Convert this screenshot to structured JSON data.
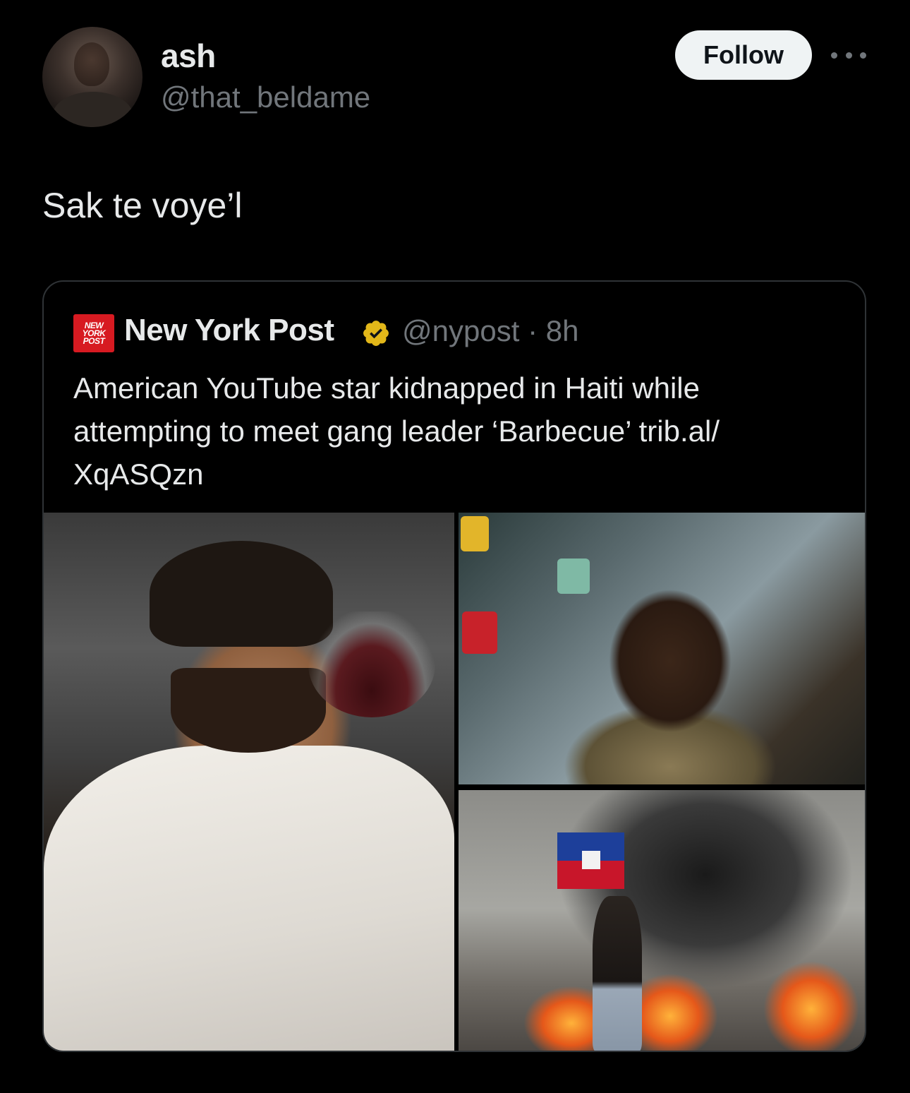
{
  "author": {
    "display_name": "ash",
    "handle": "@that_beldame",
    "follow_label": "Follow"
  },
  "tweet": {
    "text": "Sak te voye’l"
  },
  "quoted": {
    "logo_text": [
      "NEW",
      "YORK",
      "POST"
    ],
    "name": "New York Post",
    "verified": true,
    "handle": "@nypost",
    "separator": "·",
    "time": "8h",
    "text": "American YouTube star kidnapped in Haiti while attempting to meet gang leader ‘Barbecue’ trib.al/ XqASQzn",
    "media": [
      {
        "name": "man-with-wine-glass-photo"
      },
      {
        "name": "gang-leader-crowd-photo"
      },
      {
        "name": "protester-with-flag-fires-photo"
      }
    ]
  },
  "colors": {
    "background": "#000000",
    "text_primary": "#e7e9ea",
    "text_secondary": "#71767b",
    "follow_bg": "#eff3f4",
    "verified_gold": "#e2b719",
    "nyp_red": "#d71a21"
  },
  "icons": [
    "more-icon",
    "verified-badge-icon",
    "nypost-logo"
  ]
}
